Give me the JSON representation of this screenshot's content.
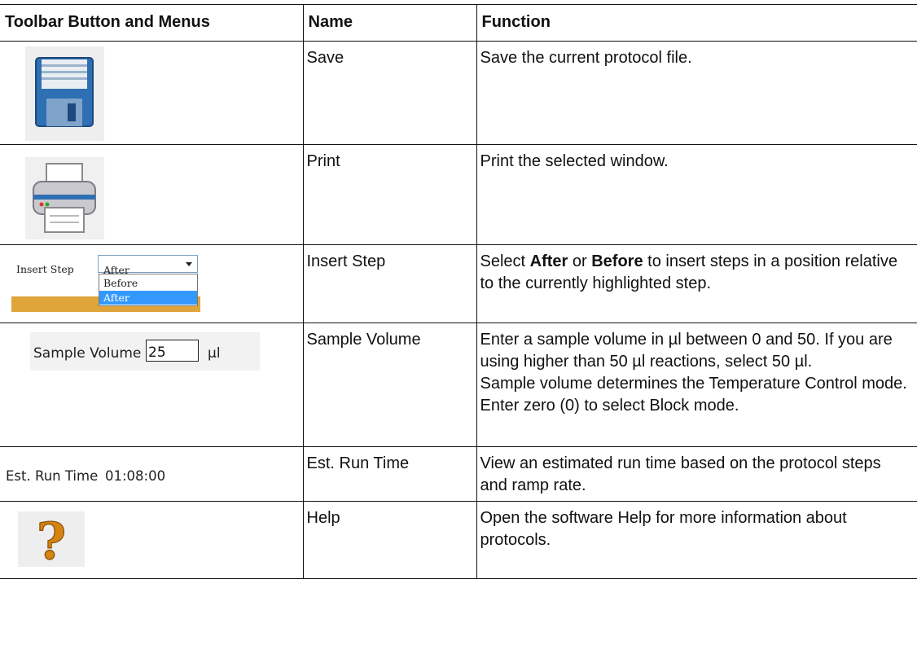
{
  "headers": {
    "col1": "Toolbar Button and Menus",
    "col2": "Name",
    "col3": "Function"
  },
  "rows": [
    {
      "icon": "floppy-disk-save-icon",
      "name": "Save",
      "function": "Save the current protocol file."
    },
    {
      "icon": "printer-icon",
      "name": "Print",
      "function": "Print the selected window."
    },
    {
      "widget": {
        "label": "Insert Step",
        "selected": "After",
        "options": [
          "Before",
          "After"
        ]
      },
      "name": "Insert Step",
      "function_parts": {
        "p1": "Select ",
        "b1": "After",
        "p2": " or ",
        "b2": "Before",
        "p3": " to insert steps in a position relative to the currently highlighted step."
      }
    },
    {
      "widget": {
        "label": "Sample Volume",
        "value": "25",
        "unit": "µl"
      },
      "name": "Sample Volume",
      "function_lines": [
        "Enter a sample volume in µl between 0 and 50. If you are using higher than 50 µl reactions, select 50 µl.",
        "Sample volume determines the Temperature Control mode. Enter zero (0) to select Block mode."
      ]
    },
    {
      "widget": {
        "label": "Est. Run Time",
        "value": "01:08:00"
      },
      "name": "Est. Run Time",
      "function": "View an estimated run time based on the protocol steps and ramp rate."
    },
    {
      "icon": "question-mark-help-icon",
      "name": "Help",
      "function": "Open the software Help for more information about protocols."
    }
  ],
  "colors": {
    "floppy_blue": "#2f6fb3",
    "highlight_blue": "#3399ff",
    "ribbon_orange": "#dfa43a",
    "help_orange": "#d4850f"
  }
}
